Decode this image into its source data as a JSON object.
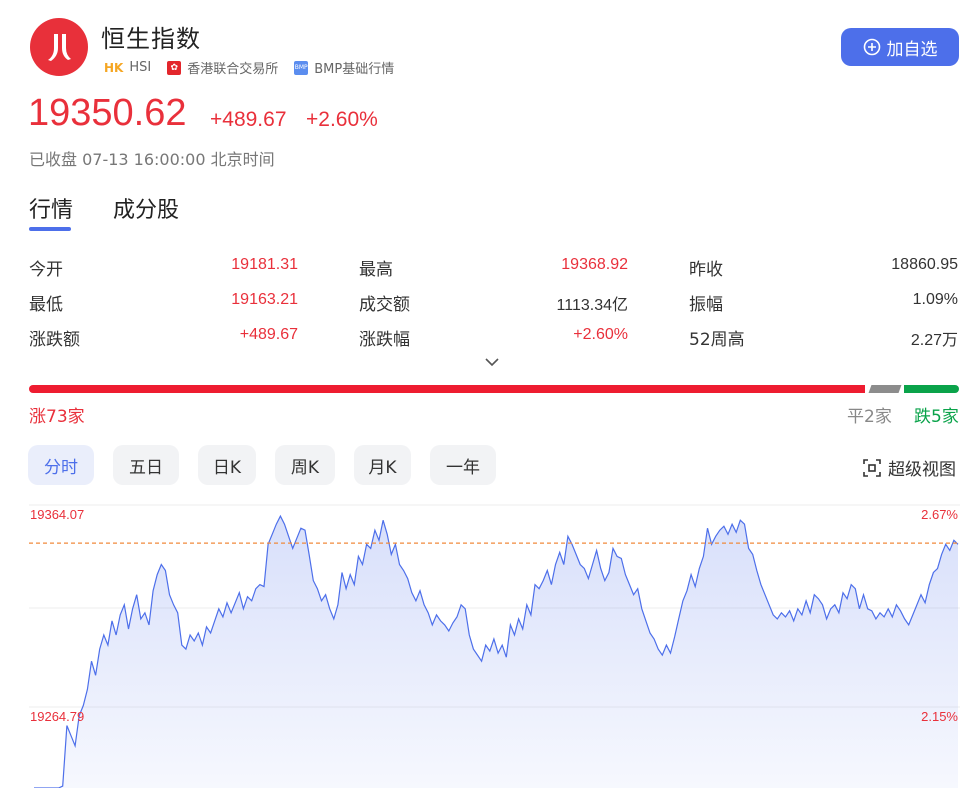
{
  "header": {
    "title": "恒生指数",
    "market_tag": "HK",
    "code": "HSI",
    "exchange": "香港联合交易所",
    "feed_icon_text": "BMP",
    "feed": "BMP基础行情",
    "add_button": "加自选"
  },
  "quote": {
    "price": "19350.62",
    "change": "+489.67",
    "change_pct": "+2.60%",
    "status": "已收盘 07-13 16:00:00 北京时间"
  },
  "tabs": [
    "行情",
    "成分股"
  ],
  "stats": [
    {
      "label": "今开",
      "value": "19181.31",
      "color": "#e9303b"
    },
    {
      "label": "最高",
      "value": "19368.92",
      "color": "#e9303b"
    },
    {
      "label": "昨收",
      "value": "18860.95",
      "color": "#333333"
    },
    {
      "label": "最低",
      "value": "19163.21",
      "color": "#e9303b"
    },
    {
      "label": "成交额",
      "value": "1113.34亿",
      "color": "#333333"
    },
    {
      "label": "振幅",
      "value": "1.09%",
      "color": "#333333"
    },
    {
      "label": "涨跌额",
      "value": "+489.67",
      "color": "#e9303b"
    },
    {
      "label": "涨跌幅",
      "value": "+2.60%",
      "color": "#e9303b"
    },
    {
      "label": "52周高",
      "value": "2.27万",
      "color": "#333333"
    }
  ],
  "breadth": {
    "up_label": "涨73家",
    "flat_label": "平2家",
    "down_label": "跌5家",
    "up": 73,
    "flat": 2,
    "down": 5,
    "colors": {
      "up": "#ee1c30",
      "flat": "#8c8c8c",
      "down": "#0aa34a"
    }
  },
  "periods": [
    "分时",
    "五日",
    "日K",
    "周K",
    "月K",
    "一年"
  ],
  "active_period": "分时",
  "super_view": "超级视图",
  "chart_data": {
    "type": "area",
    "y_tick_left": [
      "19364.07",
      "19264.79"
    ],
    "y_tick_right": [
      "2.67%",
      "2.15%"
    ],
    "ref_value": 19350.62,
    "ylim": [
      19190,
      19370
    ],
    "line_color": "#4d6fea",
    "values": [
      19200,
      19203,
      19190,
      19186,
      19182,
      19190,
      19205,
      19230,
      19260,
      19255,
      19250,
      19265,
      19270,
      19278,
      19292,
      19285,
      19298,
      19305,
      19300,
      19312,
      19305,
      19315,
      19320,
      19308,
      19318,
      19325,
      19313,
      19316,
      19310,
      19327,
      19335,
      19340,
      19337,
      19325,
      19320,
      19316,
      19300,
      19298,
      19305,
      19302,
      19306,
      19300,
      19309,
      19306,
      19312,
      19318,
      19314,
      19321,
      19316,
      19321,
      19326,
      19318,
      19324,
      19322,
      19328,
      19330,
      19329,
      19350,
      19355,
      19360,
      19364,
      19360,
      19354,
      19348,
      19353,
      19358,
      19357,
      19345,
      19332,
      19328,
      19322,
      19325,
      19318,
      19313,
      19320,
      19336,
      19328,
      19335,
      19330,
      19344,
      19340,
      19350,
      19348,
      19357,
      19352,
      19362,
      19355,
      19345,
      19350,
      19340,
      19337,
      19333,
      19326,
      19322,
      19327,
      19320,
      19316,
      19310,
      19315,
      19312,
      19310,
      19307,
      19311,
      19314,
      19320,
      19318,
      19305,
      19298,
      19295,
      19292,
      19300,
      19297,
      19303,
      19296,
      19300,
      19294,
      19310,
      19305,
      19313,
      19308,
      19320,
      19315,
      19330,
      19328,
      19332,
      19337,
      19330,
      19340,
      19346,
      19340,
      19354,
      19350,
      19345,
      19340,
      19338,
      19333,
      19340,
      19347,
      19338,
      19332,
      19336,
      19348,
      19344,
      19343,
      19335,
      19330,
      19325,
      19328,
      19318,
      19312,
      19306,
      19303,
      19298,
      19295,
      19300,
      19296,
      19304,
      19313,
      19322,
      19327,
      19335,
      19329,
      19338,
      19344,
      19358,
      19350,
      19354,
      19357,
      19359,
      19355,
      19360,
      19356,
      19362,
      19360,
      19348,
      19345,
      19337,
      19330,
      19325,
      19320,
      19315,
      19313,
      19316,
      19314,
      19317,
      19312,
      19318,
      19315,
      19322,
      19316,
      19325,
      19323,
      19320,
      19313,
      19318,
      19320,
      19316,
      19326,
      19323,
      19330,
      19328,
      19318,
      19325,
      19318,
      19317,
      19313,
      19316,
      19314,
      19318,
      19314,
      19320,
      19317,
      19313,
      19310,
      19315,
      19320,
      19325,
      19321,
      19330,
      19336,
      19338,
      19345,
      19350,
      19347,
      19352,
      19350
    ]
  }
}
